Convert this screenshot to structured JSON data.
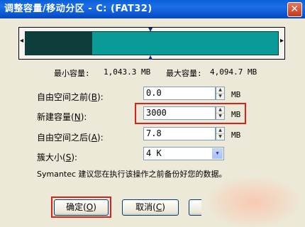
{
  "window": {
    "title": "调整容量/移动分区 - C:  (FAT32)",
    "close_symbol": "✕"
  },
  "partition_bar": {
    "used_fraction": 0.265,
    "used_color": "#0e3e3c",
    "free_color": "#0a9b98",
    "left_handle": "◂",
    "right_handle": "▸",
    "top_marker": "▼",
    "bottom_marker": "▲"
  },
  "sizes": {
    "min_label": "最小容量:",
    "min_value": "1,043.3 MB",
    "max_label": "最大容量:",
    "max_value": "4,094.7 MB"
  },
  "fields": {
    "before": {
      "label": "自由空间之前",
      "hotkey": "B",
      "value": "0.0",
      "unit": "MB"
    },
    "new_size": {
      "label": "新建容量",
      "hotkey": "N",
      "value": "3000",
      "unit": "MB"
    },
    "after": {
      "label": "自由空间之后",
      "hotkey": "A",
      "value": "7.8",
      "unit": "MB"
    },
    "cluster": {
      "label": "簇大小",
      "hotkey": "S",
      "value": "4 K"
    }
  },
  "spinner": {
    "up": "▲",
    "down": "▼"
  },
  "dropdown_arrow": "▼",
  "note": "Symantec 建议您在执行该操作之前备份好您的数据。",
  "buttons": {
    "ok": {
      "label": "确定",
      "hotkey": "O"
    },
    "cancel": {
      "label": "取消",
      "hotkey": "C"
    }
  },
  "highlight_color": "#d9231a"
}
